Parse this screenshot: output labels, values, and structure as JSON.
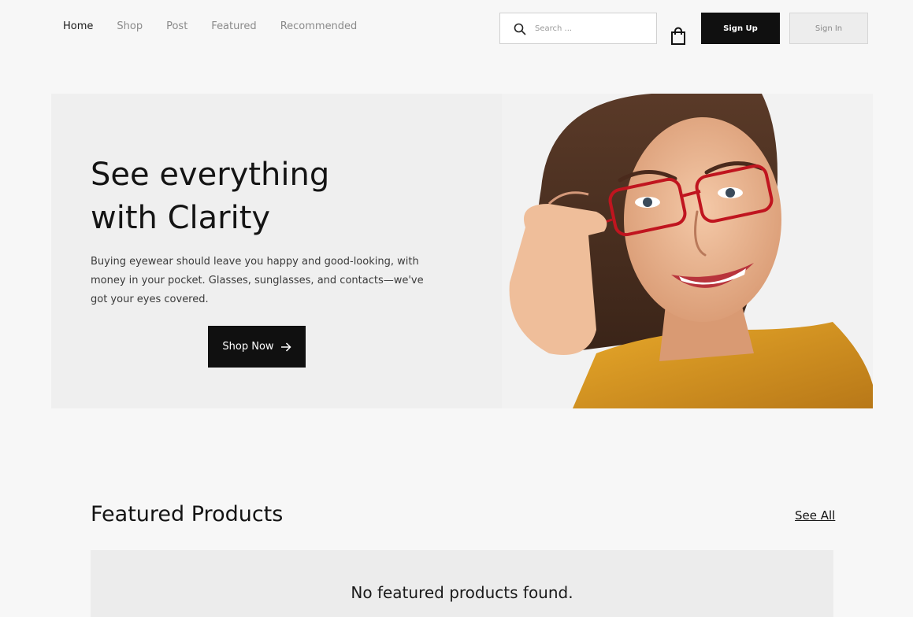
{
  "nav": {
    "links": [
      {
        "label": "Home",
        "active": true
      },
      {
        "label": "Shop",
        "active": false
      },
      {
        "label": "Post",
        "active": false
      },
      {
        "label": "Featured",
        "active": false
      },
      {
        "label": "Recommended",
        "active": false
      }
    ],
    "search_placeholder": "Search ...",
    "search_icon": "search-icon",
    "cart_icon": "shopping-bag-icon",
    "signup_label": "Sign Up",
    "signin_label": "Sign In"
  },
  "hero": {
    "title_line1": "See everything",
    "title_line2": "with Clarity",
    "description": "Buying eyewear should leave you happy and good-looking, with money in your pocket. Glasses, sunglasses, and contacts—we've got your eyes covered.",
    "cta_label": "Shop Now",
    "cta_icon": "arrow-right-icon"
  },
  "featured": {
    "title": "Featured Products",
    "see_all_label": "See All",
    "empty_message": "No featured products found."
  },
  "colors": {
    "background": "#f7f7f7",
    "hero_background": "#efefef",
    "primary_button": "#101010",
    "secondary_button": "#ededed",
    "nav_inactive": "#8a8a8a",
    "empty_panel": "#ececec"
  }
}
